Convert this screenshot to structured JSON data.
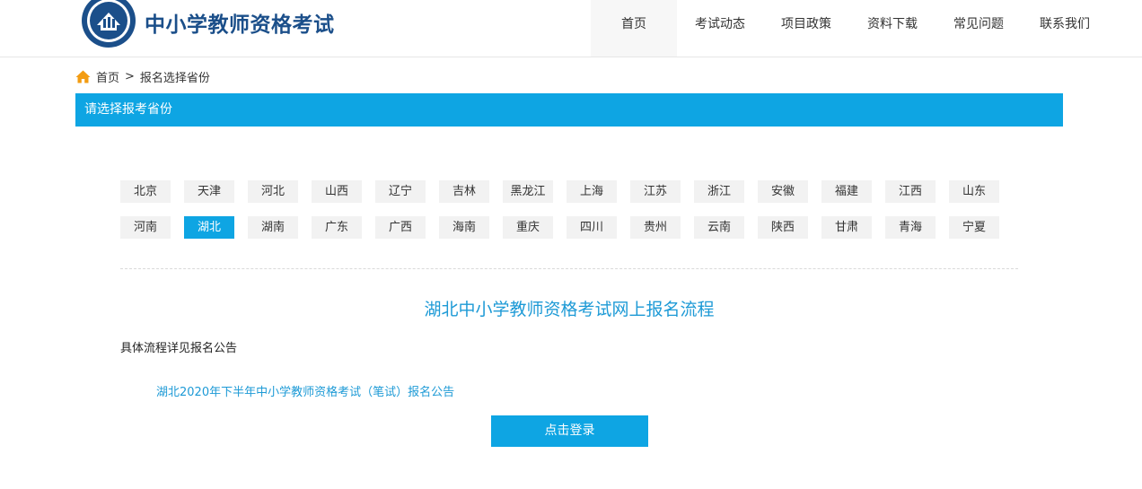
{
  "header": {
    "site_title": "中小学教师资格考试",
    "nav": [
      "首页",
      "考试动态",
      "项目政策",
      "资料下载",
      "常见问题",
      "联系我们"
    ],
    "active_nav": 0
  },
  "breadcrumb": {
    "home": "首页",
    "separator": ">",
    "current": "报名选择省份"
  },
  "section_title": "请选择报考省份",
  "provinces": [
    "北京",
    "天津",
    "河北",
    "山西",
    "辽宁",
    "吉林",
    "黑龙江",
    "上海",
    "江苏",
    "浙江",
    "安徽",
    "福建",
    "江西",
    "山东",
    "河南",
    "湖北",
    "湖南",
    "广东",
    "广西",
    "海南",
    "重庆",
    "四川",
    "贵州",
    "云南",
    "陕西",
    "甘肃",
    "青海",
    "宁夏"
  ],
  "selected_province": "湖北",
  "process": {
    "title": "湖北中小学教师资格考试网上报名流程",
    "detail": "具体流程详见报名公告",
    "notice_link": "湖北2020年下半年中小学教师资格考试（笔试）报名公告",
    "login_button": "点击登录"
  },
  "colors": {
    "accent": "#0ea5e3",
    "link": "#1d9ad6",
    "title": "#1b4f8a",
    "home_icon": "#f39c12"
  },
  "icons": {
    "logo": "exam-logo-emblem",
    "home": "home-icon"
  }
}
